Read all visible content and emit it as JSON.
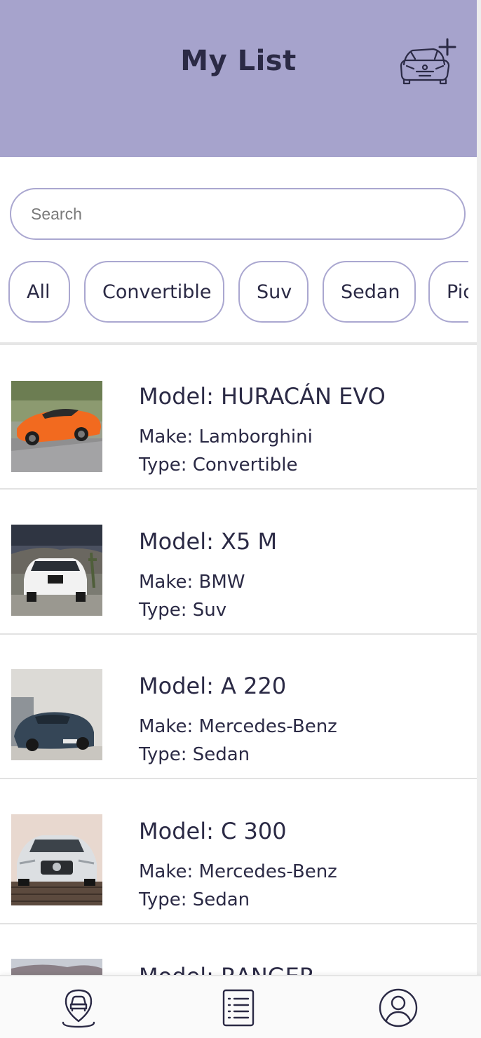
{
  "header": {
    "title": "My List",
    "add_icon": "car-plus-icon"
  },
  "search": {
    "placeholder": "Search",
    "value": ""
  },
  "filters": {
    "selected": "All",
    "chips": [
      {
        "label": "All"
      },
      {
        "label": "Convertible"
      },
      {
        "label": "Suv"
      },
      {
        "label": "Sedan"
      },
      {
        "label": "Pickup"
      }
    ]
  },
  "cars": [
    {
      "model": "Model: HURACÁN EVO",
      "make": "Make: Lamborghini",
      "type": "Type: Convertible",
      "image": "orange-sports-car-photo"
    },
    {
      "model": "Model: X5 M",
      "make": "Make: BMW",
      "type": "Type: Suv",
      "image": "white-suv-photo"
    },
    {
      "model": "Model: A 220",
      "make": "Make: Mercedes-Benz",
      "type": "Type: Sedan",
      "image": "dark-blue-sedan-photo"
    },
    {
      "model": "Model: C 300",
      "make": "Make: Mercedes-Benz",
      "type": "Type: Sedan",
      "image": "silver-sedan-photo"
    },
    {
      "model": "Model: RANGER",
      "make": "",
      "type": "",
      "image": "pickup-photo"
    }
  ],
  "bottom_nav": {
    "items": [
      {
        "icon": "car-location-icon"
      },
      {
        "icon": "list-icon"
      },
      {
        "icon": "profile-icon"
      }
    ]
  },
  "colors": {
    "header_bg": "#a6a3cc",
    "accent_border": "#aaa7d0",
    "text": "#2b2a45"
  }
}
